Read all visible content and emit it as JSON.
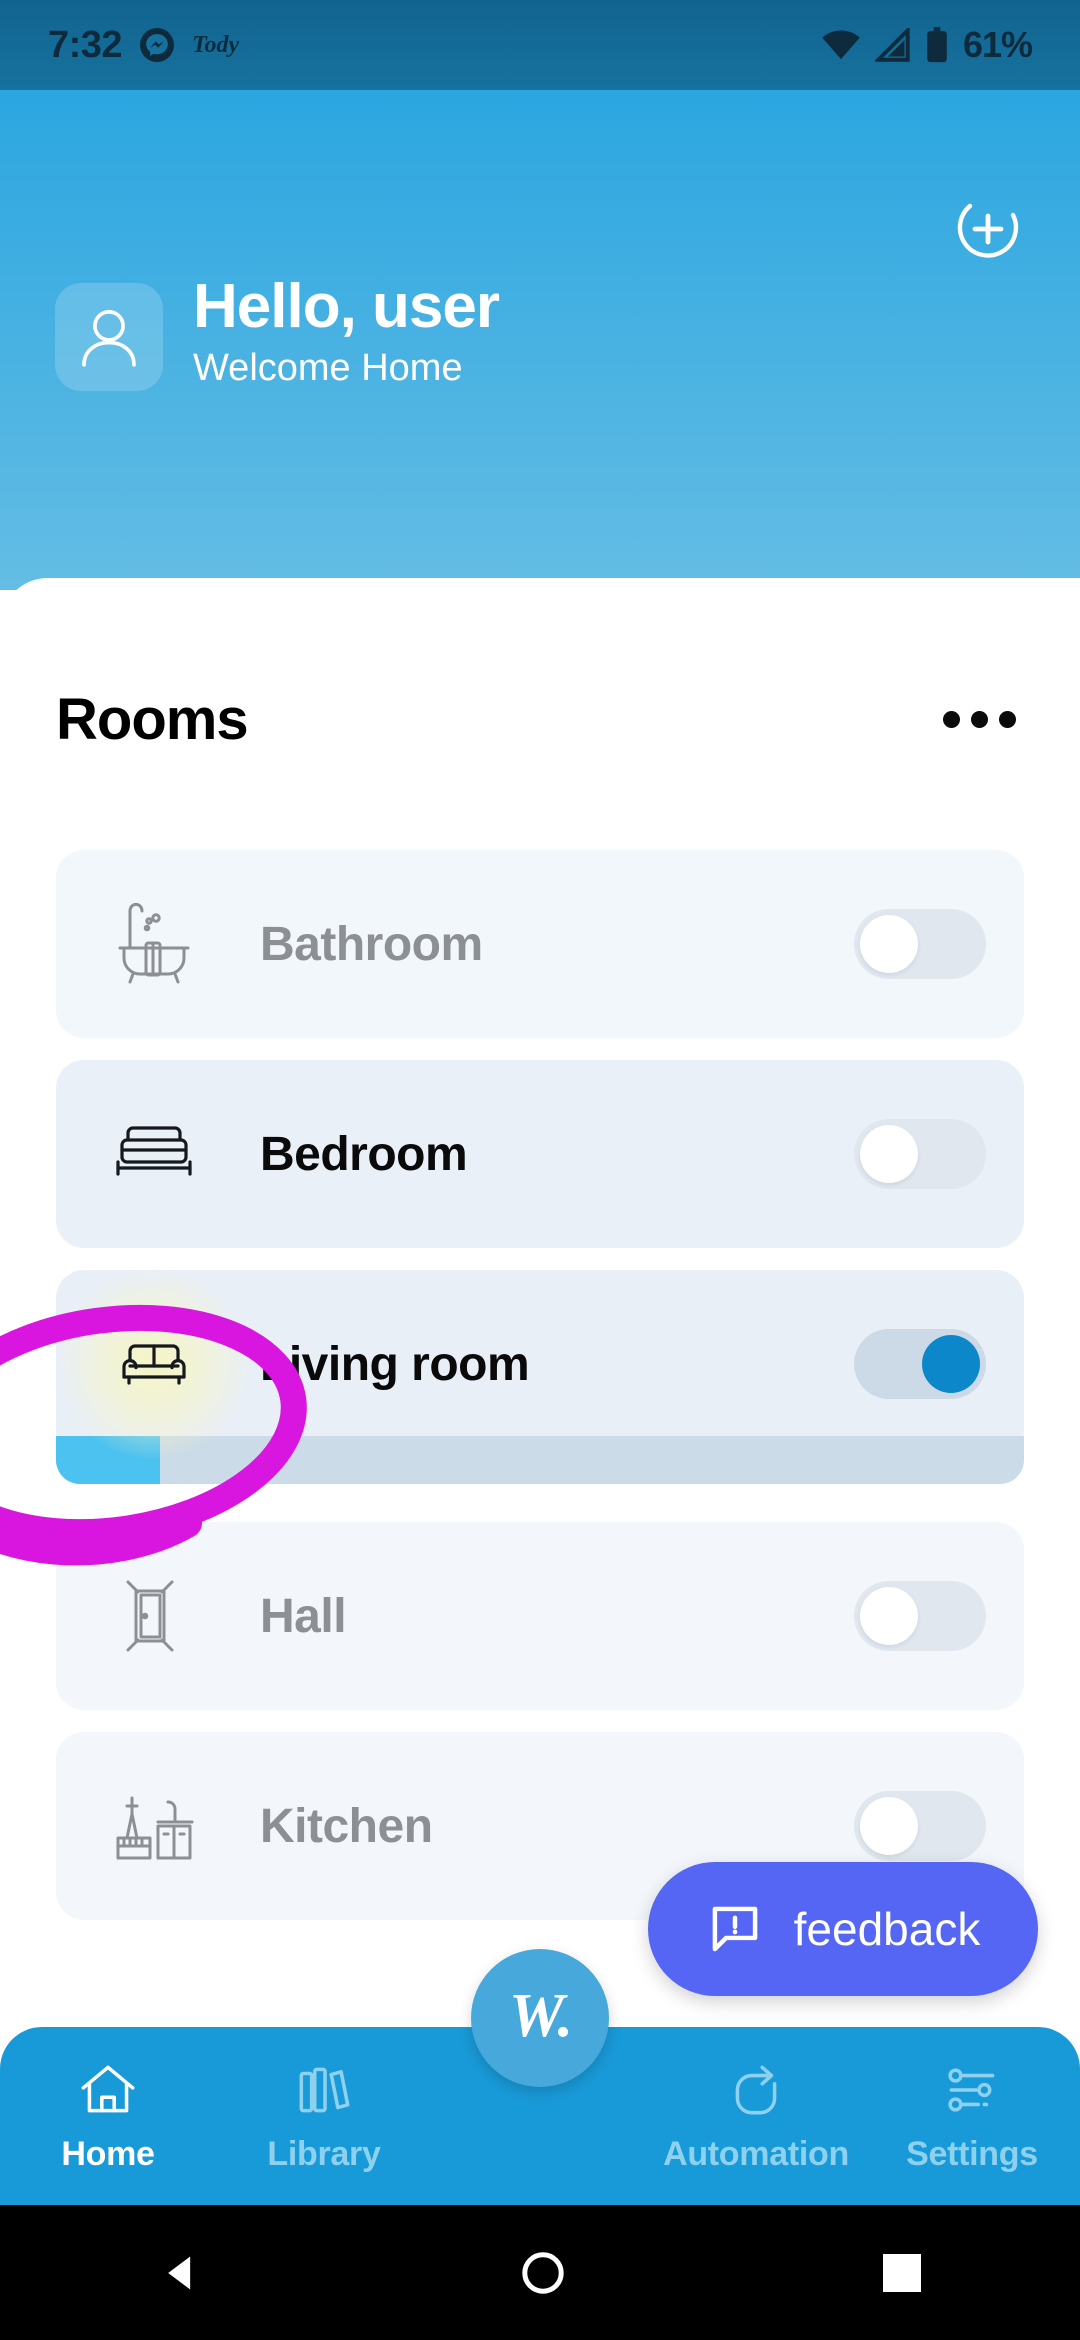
{
  "statusbar": {
    "time": "7:32",
    "messenger_icon": "messenger-icon",
    "app_icon_label": "Tody",
    "wifi_icon": "wifi-icon",
    "signal_icon": "cellular-signal-icon",
    "battery_icon": "battery-icon",
    "battery_level": "61%"
  },
  "header": {
    "add_icon": "add-circle-icon",
    "avatar_icon": "person-avatar-icon",
    "greeting": "Hello, user",
    "subtitle": "Welcome Home"
  },
  "rooms_section": {
    "title": "Rooms",
    "overflow_icon": "more-horizontal-icon"
  },
  "rooms": [
    {
      "name": "Bathroom",
      "icon": "bathtub-icon",
      "state": "off",
      "highlighted": false
    },
    {
      "name": "Bedroom",
      "icon": "bed-icon",
      "state": "off",
      "highlighted": false
    },
    {
      "name": "Living room",
      "icon": "sofa-icon",
      "state": "on",
      "highlighted": true
    },
    {
      "name": "Hall",
      "icon": "door-icon",
      "state": "off",
      "highlighted": false
    },
    {
      "name": "Kitchen",
      "icon": "kitchen-icon",
      "state": "off",
      "highlighted": false
    }
  ],
  "feedback": {
    "label": "feedback",
    "icon": "feedback-bubble-icon"
  },
  "bottom_nav": {
    "items": [
      {
        "label": "Home",
        "icon": "home-icon",
        "active": true
      },
      {
        "label": "Library",
        "icon": "books-icon",
        "active": false
      },
      {
        "label": "Automation",
        "icon": "refresh-icon",
        "active": false
      },
      {
        "label": "Settings",
        "icon": "sliders-icon",
        "active": false
      }
    ],
    "fab_label": "W.",
    "fab_icon": "app-logo-icon"
  },
  "system_nav": {
    "back_icon": "back-triangle-icon",
    "home_icon": "home-circle-icon",
    "recents_icon": "recents-square-icon"
  },
  "annotation": {
    "shape": "magenta-ellipse-circle",
    "color": "#d916e0",
    "target": "Living room"
  },
  "colors": {
    "header_blue_top": "#2ba6e0",
    "header_blue_bottom": "#64bde4",
    "statusbar_blue": "#17719e",
    "nav_blue": "#199ad8",
    "toggle_on_blue": "#0c87ca",
    "feedback_purple": "#5566f5",
    "card_bg": "#f2f7fc",
    "annotation_magenta": "#d916e0"
  }
}
